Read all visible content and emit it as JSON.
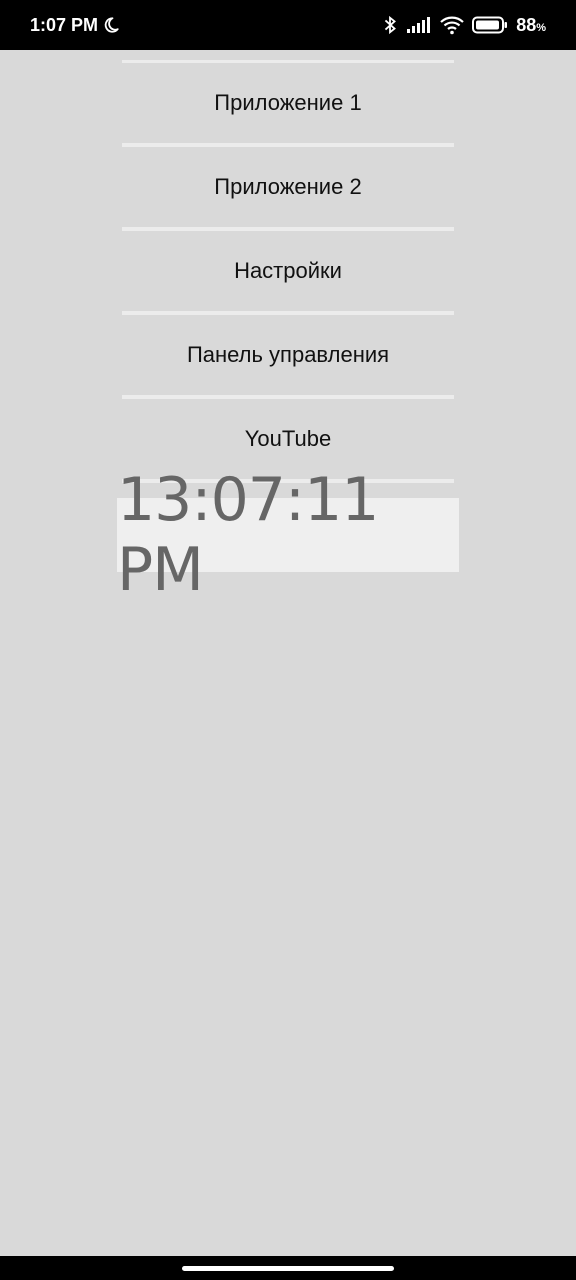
{
  "status_bar": {
    "time": "1:07 PM",
    "dnd_icon": "moon-icon",
    "icons": [
      "bluetooth-icon",
      "signal-icon",
      "wifi-icon",
      "battery-icon"
    ],
    "battery_percent": "88",
    "battery_sign": "%"
  },
  "menu": {
    "items": [
      {
        "label": "Приложение 1"
      },
      {
        "label": "Приложение 2"
      },
      {
        "label": "Настройки"
      },
      {
        "label": "Панель управления"
      },
      {
        "label": "YouTube"
      }
    ]
  },
  "clock": {
    "time": "13:07:11 PM"
  },
  "colors": {
    "background": "#d9d9d9",
    "divider": "#ececec",
    "clock_bg": "#efefef",
    "clock_text": "#666666"
  }
}
